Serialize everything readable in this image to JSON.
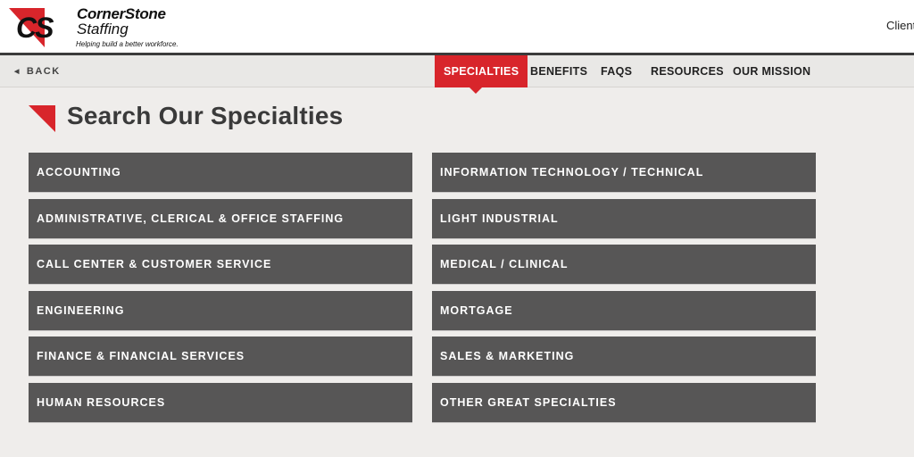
{
  "header": {
    "brand_name": "CornerStone",
    "brand_sub": "Staffing",
    "tagline": "Helping build a better workforce.",
    "logo_text": "CS",
    "client_link": "Client"
  },
  "nav": {
    "back_label": "BACK",
    "items": [
      {
        "label": "SPECIALTIES",
        "active": true
      },
      {
        "label": "BENEFITS",
        "active": false
      },
      {
        "label": "FAQS",
        "active": false
      },
      {
        "label": "RESOURCES",
        "active": false
      },
      {
        "label": "OUR MISSION",
        "active": false
      }
    ]
  },
  "page": {
    "title": "Search Our Specialties"
  },
  "specialties": {
    "left": [
      "ACCOUNTING",
      "ADMINISTRATIVE, CLERICAL & OFFICE STAFFING",
      "CALL CENTER & CUSTOMER SERVICE",
      "ENGINEERING",
      "FINANCE & FINANCIAL SERVICES",
      "HUMAN RESOURCES"
    ],
    "right": [
      "INFORMATION TECHNOLOGY / TECHNICAL",
      "LIGHT INDUSTRIAL",
      "MEDICAL / CLINICAL",
      "MORTGAGE",
      "SALES & MARKETING",
      "OTHER GREAT SPECIALTIES"
    ]
  },
  "colors": {
    "accent": "#d8252b",
    "tile": "#575656",
    "background": "#efedeb"
  }
}
